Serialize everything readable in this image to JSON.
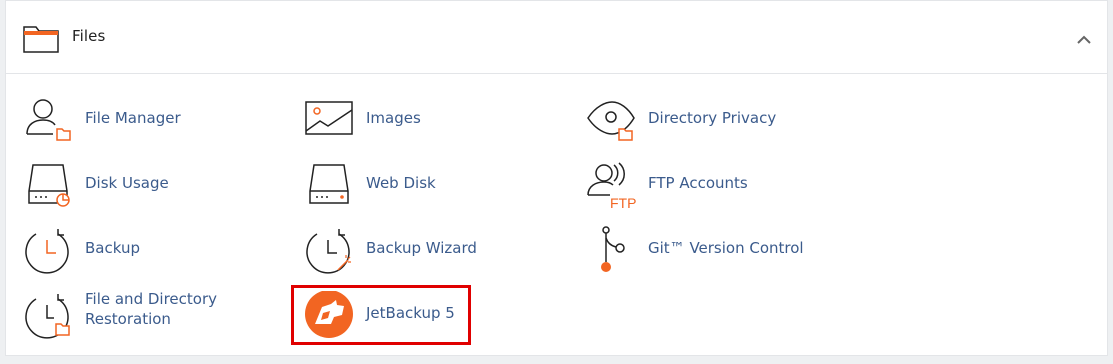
{
  "section": {
    "title": "Files",
    "collapse_icon": "chevron-up-icon"
  },
  "items": [
    {
      "label": "File Manager",
      "icon": "file-manager-icon"
    },
    {
      "label": "Images",
      "icon": "images-icon"
    },
    {
      "label": "Directory Privacy",
      "icon": "directory-privacy-icon"
    },
    {
      "label": "Disk Usage",
      "icon": "disk-usage-icon"
    },
    {
      "label": "Web Disk",
      "icon": "web-disk-icon"
    },
    {
      "label": "FTP Accounts",
      "icon": "ftp-accounts-icon",
      "icon_text": "FTP"
    },
    {
      "label": "Backup",
      "icon": "backup-icon"
    },
    {
      "label": "Backup Wizard",
      "icon": "backup-wizard-icon"
    },
    {
      "label": "Git™ Version Control",
      "icon": "git-icon"
    },
    {
      "label": "File and Directory Restoration",
      "icon": "file-restoration-icon"
    },
    {
      "label": "JetBackup 5",
      "icon": "jetbackup-icon"
    }
  ],
  "colors": {
    "accent": "#f26522",
    "link": "#3b5b8c",
    "highlight": "#e00000"
  }
}
